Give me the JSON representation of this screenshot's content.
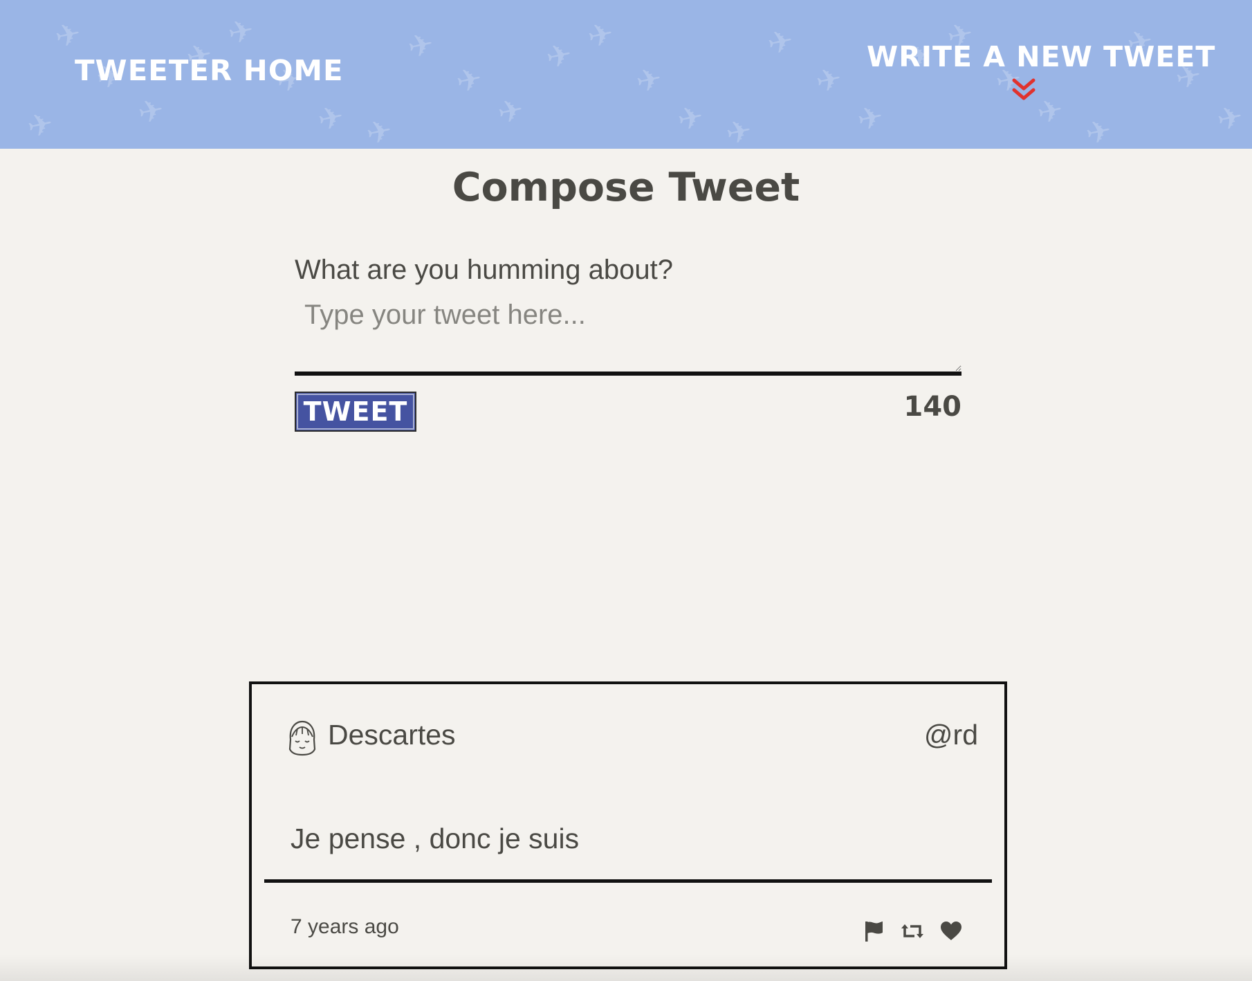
{
  "nav": {
    "home_label": "TWEETER HOME",
    "write_label": "WRITE A NEW TWEET",
    "chevron_icon": "double-chevron-down-icon",
    "bird_icon": "bird-silhouette-icon",
    "background_color": "#9ab5e6",
    "chevron_color": "#e0322e"
  },
  "compose": {
    "title": "Compose Tweet",
    "label": "What are you humming about?",
    "placeholder": "Type your tweet here...",
    "value": "",
    "button_label": "TWEET",
    "button_color": "#4553a1",
    "char_counter": "140"
  },
  "tweets": [
    {
      "avatar_icon": "girl-face-avatar-icon",
      "name": "Descartes",
      "handle": "@rd",
      "content": "Je pense , donc je suis",
      "time": "7 years ago",
      "actions": [
        "flag-icon",
        "retweet-icon",
        "heart-icon"
      ]
    }
  ],
  "colors": {
    "page_background": "#f4f2ee",
    "text": "#4a4944"
  }
}
